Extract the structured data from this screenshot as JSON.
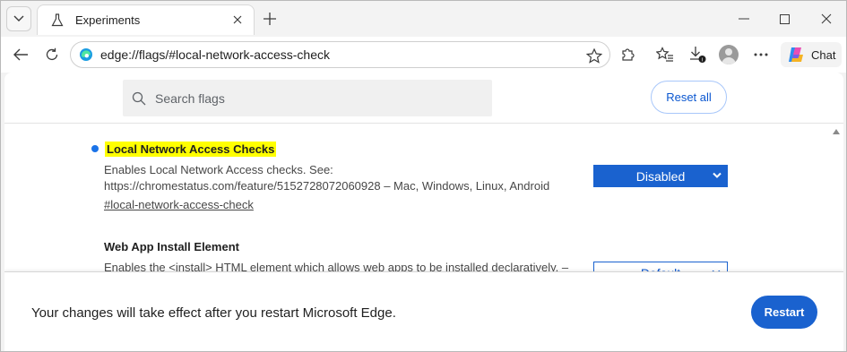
{
  "browser": {
    "tab": {
      "title": "Experiments"
    },
    "address": "edge://flags/#local-network-access-check",
    "chat_label": "Chat"
  },
  "page": {
    "search": {
      "placeholder": "Search flags"
    },
    "reset_label": "Reset all",
    "flags": [
      {
        "name": "Local Network Access Checks",
        "description_line1": "Enables Local Network Access checks. See:",
        "description_line2": "https://chromestatus.com/feature/5152728072060928 – Mac, Windows, Linux, Android",
        "link": "#local-network-access-check",
        "value": "Disabled"
      },
      {
        "name": "Web App Install Element",
        "description_line1": "Enables the <install> HTML element which allows web apps to be installed declaratively. –",
        "value": "Default"
      }
    ],
    "restart": {
      "message": "Your changes will take effect after you restart Microsoft Edge.",
      "button": "Restart"
    }
  },
  "colors": {
    "accent": "#1a62cf",
    "highlight": "#ffff00",
    "modified_dot": "#1a73e8"
  },
  "icons": [
    "tab-actions-icon",
    "flask-icon",
    "close-icon",
    "new-tab-icon",
    "minimize-icon",
    "maximize-icon",
    "window-close-icon",
    "back-icon",
    "refresh-icon",
    "edge-icon",
    "favorite-star-icon",
    "extensions-icon",
    "favorites-icon",
    "downloads-icon",
    "profile-icon",
    "more-icon",
    "copilot-icon",
    "search-icon",
    "chevron-down-icon",
    "scroll-up-icon"
  ]
}
